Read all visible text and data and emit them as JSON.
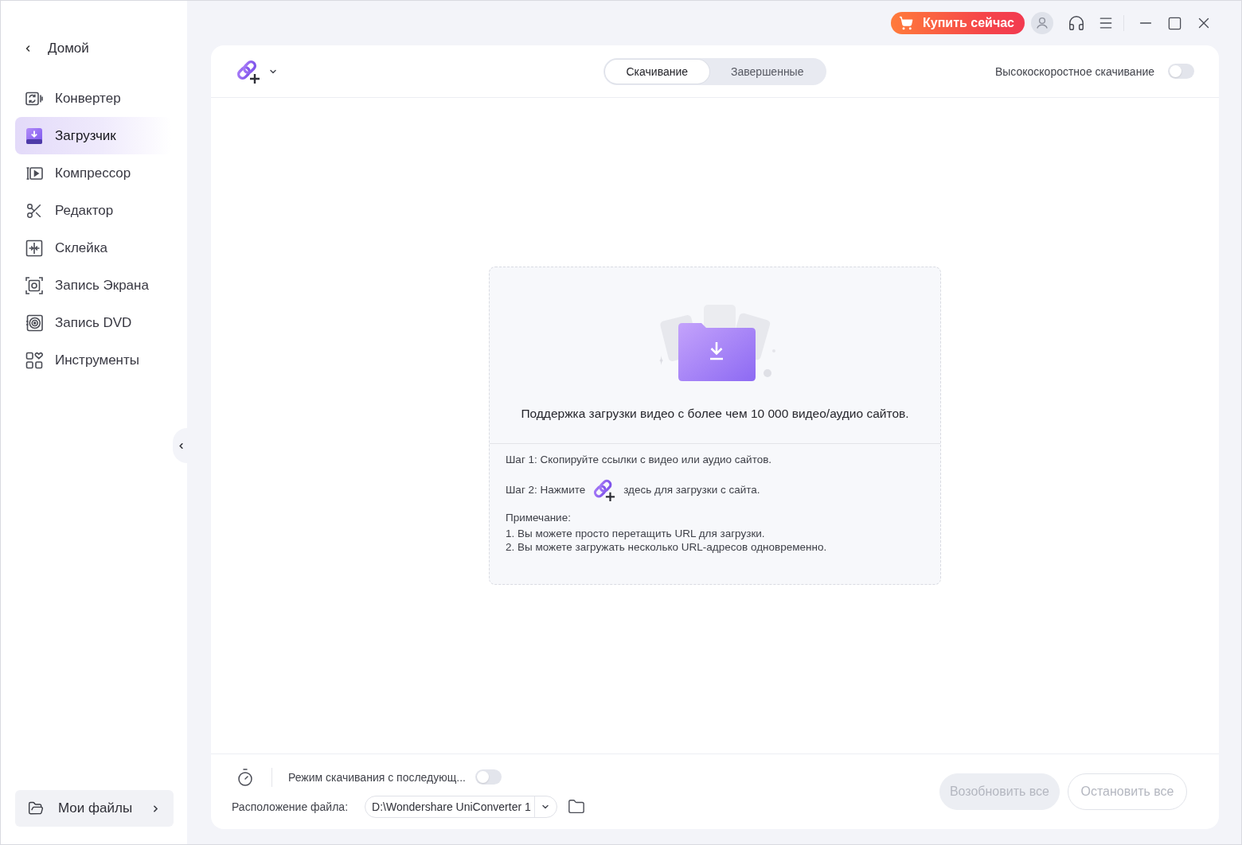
{
  "title_bar": {
    "buy_button": {
      "label": "Купить сейчас"
    }
  },
  "sidebar": {
    "back": {
      "label": "Домой"
    },
    "items": [
      {
        "label": "Конвертер",
        "selected": false
      },
      {
        "label": "Загрузчик",
        "selected": true
      },
      {
        "label": "Компрессор",
        "selected": false
      },
      {
        "label": "Редактор",
        "selected": false
      },
      {
        "label": "Склейка",
        "selected": false
      },
      {
        "label": "Запись Экрана",
        "selected": false
      },
      {
        "label": "Запись DVD",
        "selected": false
      },
      {
        "label": "Инструменты",
        "selected": false
      }
    ],
    "my_files": {
      "label": "Мои файлы"
    }
  },
  "toolbar": {
    "tabs": [
      {
        "label": "Скачивание",
        "selected": true
      },
      {
        "label": "Завершенные",
        "selected": false
      }
    ],
    "high_speed": {
      "label": "Высокоскоростное скачивание",
      "on": false
    }
  },
  "drop_zone": {
    "headline": "Поддержка загрузки видео с более чем 10 000 видео/аудио сайтов.",
    "step_1": "Шаг 1: Скопируйте ссылки с видео или аудио сайтов.",
    "step_2_before": "Шаг 2: Нажмите",
    "step_2_after": "здесь для загрузки с сайта.",
    "note_title": "Примечание:",
    "notes": [
      "1. Вы можете просто перетащить URL для загрузки.",
      "2. Вы можете загружать несколько URL-адресов одновременно."
    ]
  },
  "footer": {
    "download_mode": {
      "label": "Режим скачивания с последующ...",
      "on": false
    },
    "file_location": {
      "label": "Расположение файла:",
      "value": "D:\\Wondershare UniConverter 1"
    },
    "buttons": [
      {
        "label": "Возобновить все",
        "kind": "filled",
        "disabled": true
      },
      {
        "label": "Остановить все",
        "kind": "outlined",
        "disabled": true
      }
    ]
  }
}
